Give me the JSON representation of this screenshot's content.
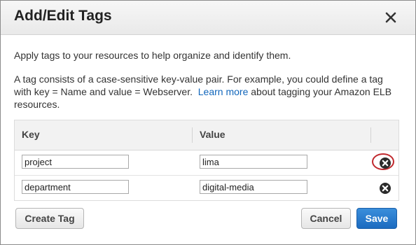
{
  "dialog": {
    "title": "Add/Edit Tags",
    "close_icon": "close-icon"
  },
  "intro": {
    "line1": "Apply tags to your resources to help organize and identify them.",
    "line2_before": "A tag consists of a case-sensitive key-value pair. For example, you could define a tag with key = Name and value = Webserver.",
    "link_text": "Learn more",
    "line2_after": "about tagging your Amazon ELB resources."
  },
  "table": {
    "headers": {
      "key": "Key",
      "value": "Value"
    },
    "rows": [
      {
        "key": "project",
        "value": "lima",
        "remove_icon": "remove-circle-icon",
        "highlighted": true
      },
      {
        "key": "department",
        "value": "digital-media",
        "remove_icon": "remove-circle-icon",
        "highlighted": false
      }
    ]
  },
  "buttons": {
    "create_tag": "Create Tag",
    "cancel": "Cancel",
    "save": "Save"
  },
  "colors": {
    "primary": "#1b6bc0",
    "link": "#1166bb",
    "highlight": "#c0282d"
  }
}
